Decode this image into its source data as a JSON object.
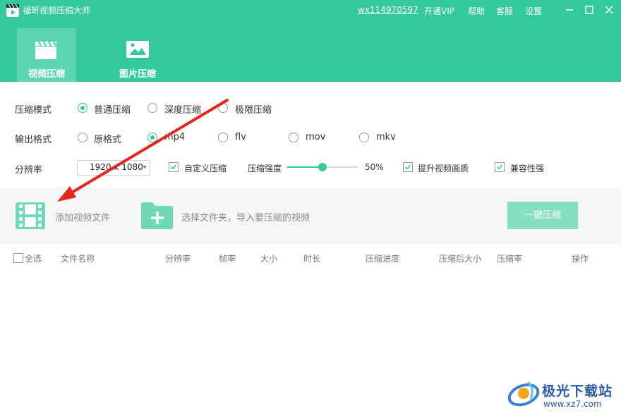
{
  "app": {
    "title": "福昕视频压缩大师",
    "user": "wx114970597",
    "menu": [
      "开通VIP",
      "帮助",
      "客服",
      "设置"
    ],
    "accent_color": "#33c99b"
  },
  "tabs": [
    {
      "label": "视频压缩",
      "icon": "clapperboard-icon",
      "active": true
    },
    {
      "label": "图片压缩",
      "icon": "image-icon",
      "active": false
    }
  ],
  "settings": {
    "mode": {
      "label": "压缩模式",
      "options": [
        "普通压缩",
        "深度压缩",
        "极限压缩"
      ],
      "selected": "普通压缩"
    },
    "format": {
      "label": "输出格式",
      "options": [
        "原格式",
        "mp4",
        "flv",
        "mov",
        "mkv"
      ],
      "selected": "mp4"
    },
    "resolution": {
      "label": "分辨率",
      "value": "1920 x 1080"
    },
    "custom_compress": {
      "label": "自定义压缩",
      "checked": true
    },
    "strength": {
      "label": "压缩强度",
      "value_text": "50%",
      "value": 0.5
    },
    "enhance_quality": {
      "label": "提升视频画质",
      "checked": true
    },
    "compat": {
      "label": "兼容性强",
      "checked": true
    }
  },
  "actions": {
    "add_video": "添加视频文件",
    "choose_folder": "选择文件夹，导入要压缩的视频",
    "compress_button": "一键压缩"
  },
  "table": {
    "select_all": "全选",
    "columns": [
      "文件名称",
      "分辨率",
      "帧率",
      "大小",
      "时长",
      "压缩进度",
      "压缩后大小",
      "压缩率",
      "操作"
    ]
  },
  "watermark": {
    "title": "极光下载站",
    "url": "www.xz7.com"
  }
}
